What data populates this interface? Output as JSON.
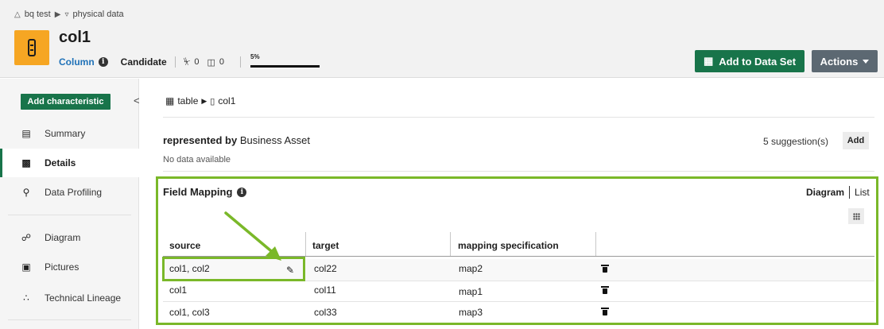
{
  "breadcrumbs": {
    "community": "bq test",
    "domain": "physical data"
  },
  "asset": {
    "name": "col1",
    "type": "Column",
    "status": "Candidate",
    "tags_count": "0",
    "comments_count": "0",
    "completion_label": "5%",
    "completion_fraction": 0.05
  },
  "header_buttons": {
    "add_to_dataset": "Add to Data Set",
    "actions": "Actions"
  },
  "sidebar": {
    "add_characteristic": "Add characteristic",
    "collapse": "<",
    "items": [
      {
        "label": "Summary",
        "icon": "clipboard-icon"
      },
      {
        "label": "Details",
        "icon": "details-icon",
        "active": true
      },
      {
        "label": "Data Profiling",
        "icon": "profiling-icon"
      },
      {
        "label": "Diagram",
        "icon": "diagram-icon"
      },
      {
        "label": "Pictures",
        "icon": "picture-icon"
      },
      {
        "label": "Technical Lineage",
        "icon": "lineage-icon"
      }
    ]
  },
  "path": {
    "table": "table",
    "column": "col1"
  },
  "represented_by": {
    "prefix": "represented by",
    "target": "Business Asset",
    "empty": "No data available",
    "suggestions": "5 suggestion(s)",
    "add_label": "Add"
  },
  "field_mapping": {
    "title": "Field Mapping",
    "view_diagram": "Diagram",
    "view_list": "List",
    "columns": [
      "source",
      "target",
      "mapping specification"
    ],
    "rows": [
      {
        "source": "col1,  col2",
        "target": "col22",
        "spec": "map2"
      },
      {
        "source": "col1",
        "target": "col11",
        "spec": "map1"
      },
      {
        "source": "col1,  col3",
        "target": "col33",
        "spec": "map3"
      }
    ]
  },
  "colors": {
    "accent_green": "#18744a",
    "highlight_green": "#7ab829",
    "asset_orange": "#f6a623",
    "actions_gray": "#5c6872"
  }
}
